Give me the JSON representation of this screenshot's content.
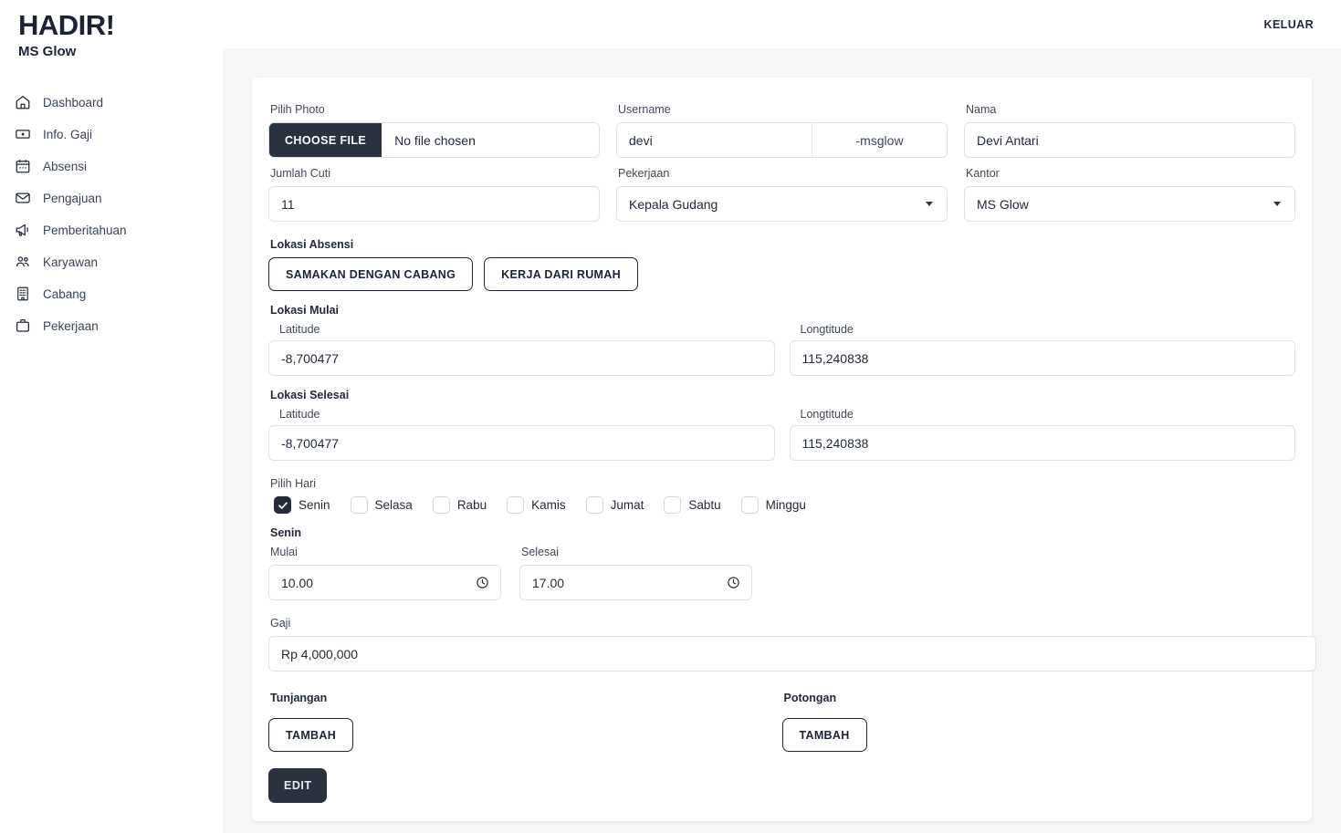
{
  "brand": {
    "title": "HADIR!",
    "subtitle": "MS Glow"
  },
  "topbar": {
    "logout_label": "KELUAR"
  },
  "sidebar": {
    "items": [
      {
        "label": "Dashboard",
        "icon": "home-icon"
      },
      {
        "label": "Info. Gaji",
        "icon": "banknote-icon"
      },
      {
        "label": "Absensi",
        "icon": "calendar-icon"
      },
      {
        "label": "Pengajuan",
        "icon": "envelope-icon"
      },
      {
        "label": "Pemberitahuan",
        "icon": "megaphone-icon"
      },
      {
        "label": "Karyawan",
        "icon": "users-icon"
      },
      {
        "label": "Cabang",
        "icon": "building-icon"
      },
      {
        "label": "Pekerjaan",
        "icon": "briefcase-icon"
      }
    ]
  },
  "form": {
    "photo": {
      "label": "Pilih Photo",
      "button_label": "CHOOSE FILE",
      "file_status": "No file chosen"
    },
    "username": {
      "label": "Username",
      "value": "devi",
      "suffix": "-msglow"
    },
    "nama": {
      "label": "Nama",
      "value": "Devi Antari"
    },
    "jumlah_cuti": {
      "label": "Jumlah Cuti",
      "value": "11"
    },
    "pekerjaan": {
      "label": "Pekerjaan",
      "value": "Kepala Gudang"
    },
    "kantor": {
      "label": "Kantor",
      "value": "MS Glow"
    },
    "lokasi_absensi": {
      "label": "Lokasi Absensi",
      "btn_cabang": "SAMAKAN DENGAN CABANG",
      "btn_rumah": "KERJA DARI RUMAH"
    },
    "lokasi_mulai": {
      "label": "Lokasi Mulai",
      "lat_label": "Latitude",
      "lat_value": "-8,700477",
      "lng_label": "Longtitude",
      "lng_value": "115,240838"
    },
    "lokasi_selesai": {
      "label": "Lokasi Selesai",
      "lat_label": "Latitude",
      "lat_value": "-8,700477",
      "lng_label": "Longtitude",
      "lng_value": "115,240838"
    },
    "pilih_hari": {
      "label": "Pilih Hari",
      "days": [
        {
          "label": "Senin",
          "checked": true
        },
        {
          "label": "Selasa",
          "checked": false
        },
        {
          "label": "Rabu",
          "checked": false
        },
        {
          "label": "Kamis",
          "checked": false
        },
        {
          "label": "Jumat",
          "checked": false
        },
        {
          "label": "Sabtu",
          "checked": false
        },
        {
          "label": "Minggu",
          "checked": false
        }
      ]
    },
    "schedule": {
      "day_title": "Senin",
      "mulai_label": "Mulai",
      "mulai_value": "10.00",
      "selesai_label": "Selesai",
      "selesai_value": "17.00"
    },
    "gaji": {
      "label": "Gaji",
      "value": "Rp 4,000,000"
    },
    "tunjangan": {
      "label": "Tunjangan",
      "button_label": "TAMBAH"
    },
    "potongan": {
      "label": "Potongan",
      "button_label": "TAMBAH"
    },
    "submit": {
      "label": "EDIT"
    }
  },
  "colors": {
    "dark": "#2a3240",
    "page_bg": "#f5f6f8",
    "border": "#dfe3e8"
  }
}
